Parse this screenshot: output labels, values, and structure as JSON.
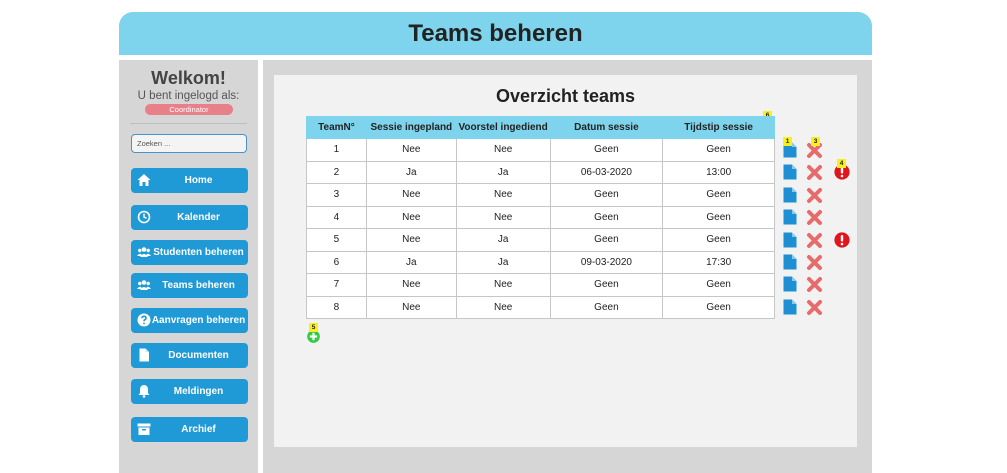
{
  "header": {
    "title": "Teams beheren"
  },
  "sidebar": {
    "welcome": "Welkom!",
    "logged_in_as": "U bent ingelogd als:",
    "role": "Coordinator",
    "search_placeholder": "Zoeken ...",
    "items": [
      {
        "label": "Home",
        "icon": "home-icon"
      },
      {
        "label": "Kalender",
        "icon": "clock-icon"
      },
      {
        "label": "Studenten beheren",
        "icon": "users-icon"
      },
      {
        "label": "Teams beheren",
        "icon": "users-icon"
      },
      {
        "label": "Aanvragen beheren",
        "icon": "question-circle-icon"
      },
      {
        "label": "Documenten",
        "icon": "document-icon"
      },
      {
        "label": "Meldingen",
        "icon": "bell-icon"
      },
      {
        "label": "Archief",
        "icon": "archive-icon"
      }
    ]
  },
  "main": {
    "title": "Overzicht teams",
    "columns": [
      "TeamN°",
      "Sessie ingepland",
      "Voorstel ingediend",
      "Datum sessie",
      "Tijdstip sessie"
    ],
    "rows": [
      [
        "1",
        "Nee",
        "Nee",
        "Geen",
        "Geen"
      ],
      [
        "2",
        "Ja",
        "Ja",
        "06-03-2020",
        "13:00"
      ],
      [
        "3",
        "Nee",
        "Nee",
        "Geen",
        "Geen"
      ],
      [
        "4",
        "Nee",
        "Nee",
        "Geen",
        "Geen"
      ],
      [
        "5",
        "Nee",
        "Ja",
        "Geen",
        "Geen"
      ],
      [
        "6",
        "Ja",
        "Ja",
        "09-03-2020",
        "17:30"
      ],
      [
        "7",
        "Nee",
        "Nee",
        "Geen",
        "Geen"
      ],
      [
        "8",
        "Nee",
        "Nee",
        "Geen",
        "Geen"
      ]
    ],
    "row_alerts": [
      false,
      true,
      false,
      false,
      true,
      false,
      false,
      false
    ],
    "badges": {
      "doc": "1",
      "delete": "3",
      "alert": "4",
      "add": "5",
      "table": "6"
    }
  },
  "colors": {
    "header": "#7dd4ec",
    "nav_button": "#1f9ad6",
    "role_badge": "#e8808a",
    "document": "#1f8fd4",
    "delete": "#e86b6b",
    "alert": "#e0161c",
    "add": "#2ecc40",
    "badge": "#f7f01a"
  }
}
